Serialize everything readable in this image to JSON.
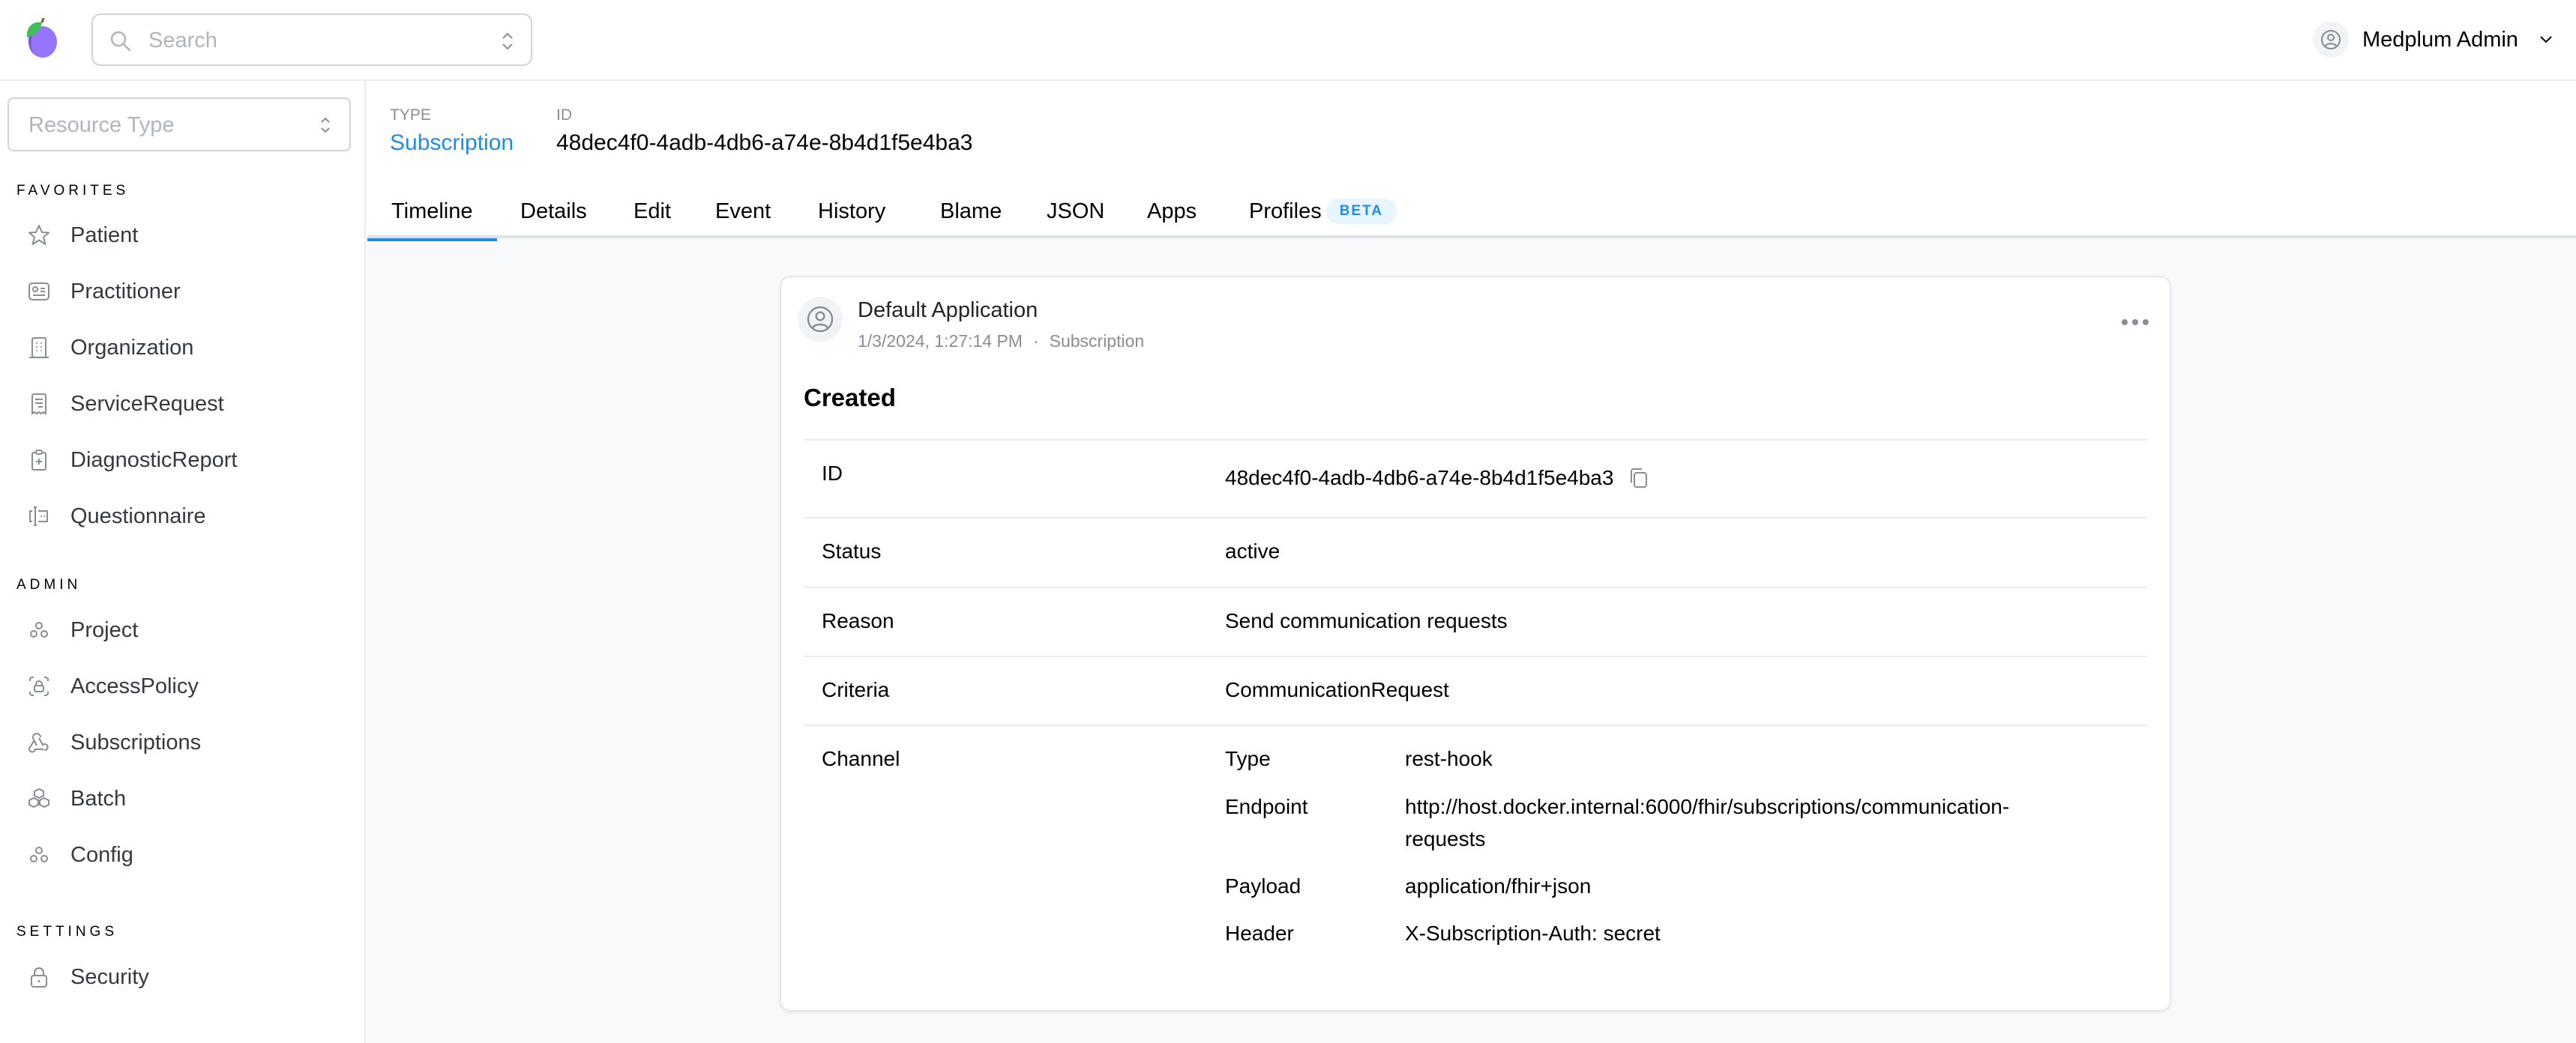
{
  "header": {
    "search_placeholder": "Search",
    "user_name": "Medplum Admin"
  },
  "sidebar": {
    "resource_type_placeholder": "Resource Type",
    "sections": [
      {
        "title": "FAVORITES",
        "items": [
          {
            "label": "Patient",
            "icon": "star-icon"
          },
          {
            "label": "Practitioner",
            "icon": "id-card-icon"
          },
          {
            "label": "Organization",
            "icon": "building-icon"
          },
          {
            "label": "ServiceRequest",
            "icon": "receipt-icon"
          },
          {
            "label": "DiagnosticReport",
            "icon": "clipboard-plus-icon"
          },
          {
            "label": "Questionnaire",
            "icon": "forms-icon"
          }
        ]
      },
      {
        "title": "ADMIN",
        "items": [
          {
            "label": "Project",
            "icon": "circles-icon"
          },
          {
            "label": "AccessPolicy",
            "icon": "lock-access-icon"
          },
          {
            "label": "Subscriptions",
            "icon": "webhook-icon"
          },
          {
            "label": "Batch",
            "icon": "boxes-icon"
          },
          {
            "label": "Config",
            "icon": "circles-icon"
          }
        ]
      },
      {
        "title": "SETTINGS",
        "items": [
          {
            "label": "Security",
            "icon": "lock-icon"
          }
        ]
      }
    ]
  },
  "resource": {
    "type_label": "TYPE",
    "type_value": "Subscription",
    "id_label": "ID",
    "id_value": "48dec4f0-4adb-4db6-a74e-8b4d1f5e4ba3"
  },
  "tabs": [
    {
      "label": "Timeline",
      "active": true
    },
    {
      "label": "Details"
    },
    {
      "label": "Edit"
    },
    {
      "label": "Event"
    },
    {
      "label": "History"
    },
    {
      "label": "Blame"
    },
    {
      "label": "JSON"
    },
    {
      "label": "Apps"
    },
    {
      "label": "Profiles",
      "badge": "BETA"
    }
  ],
  "timeline": {
    "author": "Default Application",
    "timestamp": "1/3/2024, 1:27:14 PM",
    "separator": "·",
    "resource_type": "Subscription",
    "event_title": "Created",
    "fields": [
      {
        "key": "ID",
        "value": "48dec4f0-4adb-4db6-a74e-8b4d1f5e4ba3"
      },
      {
        "key": "Status",
        "value": "active"
      },
      {
        "key": "Reason",
        "value": "Send communication requests"
      },
      {
        "key": "Criteria",
        "value": "CommunicationRequest"
      },
      {
        "key": "Channel",
        "value": ""
      }
    ],
    "channel": [
      {
        "key": "Type",
        "value": "rest-hook"
      },
      {
        "key": "Endpoint",
        "value": "http://host.docker.internal:6000/fhir/subscriptions/communication-requests"
      },
      {
        "key": "Payload",
        "value": "application/fhir+json"
      },
      {
        "key": "Header",
        "value": "X-Subscription-Auth: secret"
      }
    ]
  },
  "colors": {
    "accent": "#228be6",
    "badge_bg": "#e7f5ff",
    "muted_text": "#868e96",
    "icon_gray": "#868e96",
    "border": "#e9ecef",
    "page_bg": "#f8f9fa"
  }
}
